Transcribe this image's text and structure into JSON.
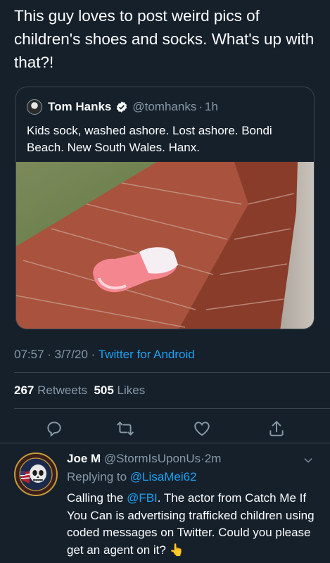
{
  "main_tweet": {
    "text": "This guy loves to post weird pics of children's shoes and socks. What's up with that?!"
  },
  "quoted_tweet": {
    "author_name": "Tom Hanks",
    "handle": "@tomhanks",
    "separator": "·",
    "time": "1h",
    "text": "Kids sock, washed ashore. Lost ashore. Bondi Beach. New South Wales. Hanx."
  },
  "meta": {
    "time": "07:57",
    "dot1": " · ",
    "date": "3/7/20",
    "dot2": " · ",
    "source": "Twitter for Android"
  },
  "stats": {
    "retweets_count": "267",
    "retweets_label": "Retweets",
    "likes_count": "505",
    "likes_label": "Likes"
  },
  "reply": {
    "name": "Joe M",
    "handle": "@StormIsUponUs",
    "separator": "·",
    "time": "2m",
    "replying_prefix": "Replying to",
    "replying_to": "@LisaMei62",
    "text_before": "Calling the ",
    "mention": "@FBI",
    "text_after": ". The actor from Catch Me If You Can is advertising trafficked children using coded messages on Twitter. Could you please get an agent on it? 👆"
  },
  "colors": {
    "background": "#15202b",
    "accent": "#1da1f2",
    "secondary_text": "#8899a6",
    "divider": "#38444d"
  },
  "icons": [
    "verified-badge-icon",
    "reply-icon",
    "retweet-icon",
    "like-icon",
    "share-icon",
    "chevron-down-icon"
  ]
}
